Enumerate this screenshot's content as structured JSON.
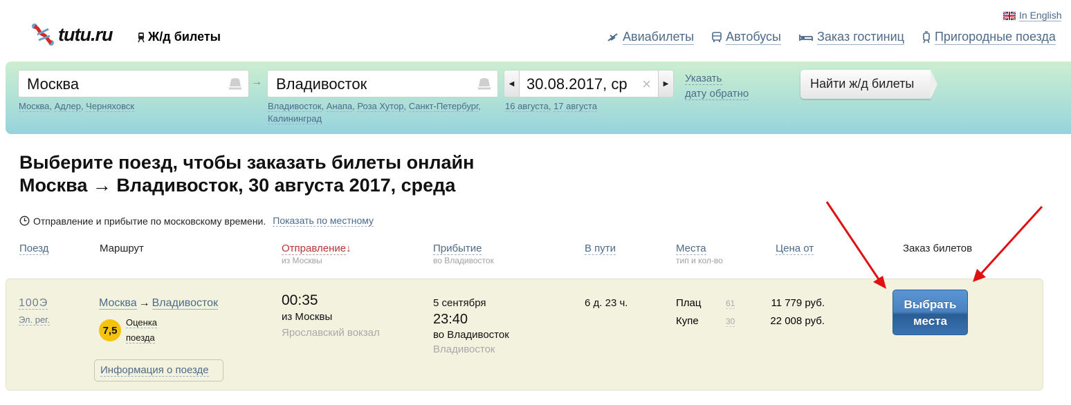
{
  "header": {
    "brand": "tutu.ru",
    "section": "Ж/д билеты",
    "language_link": "In English",
    "nav": [
      {
        "label": "Авиабилеты",
        "icon": "plane-icon"
      },
      {
        "label": "Автобусы",
        "icon": "bus-icon"
      },
      {
        "label": "Заказ гостиниц",
        "icon": "bed-icon"
      },
      {
        "label": "Пригородные поезда",
        "icon": "suburban-train-icon"
      }
    ]
  },
  "search": {
    "from_value": "Москва",
    "from_hints": [
      "Москва",
      "Адлер",
      "Черняховск"
    ],
    "to_value": "Владивосток",
    "to_hints": [
      "Владивосток",
      "Анапа",
      "Роза Хутор",
      "Санкт-Петербург",
      "Калининград"
    ],
    "date_value": "30.08.2017, ср",
    "date_hints": [
      "16 августа",
      "17 августа"
    ],
    "return_date_line1": "Указать",
    "return_date_line2": "дату обратно",
    "submit_label": "Найти ж/д билеты"
  },
  "results": {
    "title_line1": "Выберите поезд, чтобы заказать билеты онлайн",
    "title_line2": "Москва → Владивосток, 30 августа 2017, среда",
    "time_note": "Отправление и прибытие по московскому времени.",
    "time_note_link": "Показать по местному",
    "columns": {
      "train": "Поезд",
      "route": "Маршрут",
      "departure": "Отправление",
      "departure_sort": "↓",
      "departure_sub": "из Москвы",
      "arrival": "Прибытие",
      "arrival_sub": "во Владивосток",
      "duration": "В пути",
      "seats": "Места",
      "seats_sub": "тип и кол-во",
      "price": "Цена от",
      "booking": "Заказ билетов"
    },
    "trains": [
      {
        "number": "100Э",
        "type": "Эл. рег.",
        "route_from": "Москва",
        "route_to": "Владивосток",
        "rating": "7,5",
        "rating_label_1": "Оценка",
        "rating_label_2": "поезда",
        "info_button": "Информация о поезде",
        "departure_time": "00:35",
        "departure_from": "из Москвы",
        "departure_station": "Ярославский вокзал",
        "arrival_date": "5 сентября",
        "arrival_time": "23:40",
        "arrival_to": "во Владивосток",
        "arrival_station": "Владивосток",
        "duration": "6 д. 23 ч.",
        "seats": [
          {
            "type": "Плац",
            "count": "61",
            "price": "11 779 руб."
          },
          {
            "type": "Купе",
            "count": "30",
            "price": "22 008 руб."
          }
        ],
        "select_line1": "Выбрать",
        "select_line2": "места"
      }
    ]
  },
  "colors": {
    "link": "#4d6a8a",
    "sorted_column": "#b33333",
    "rating_badge": "#f6c30c",
    "select_button": "#3a73b1",
    "row_background": "#f3f2df",
    "annotation_arrow": "#e01010"
  }
}
